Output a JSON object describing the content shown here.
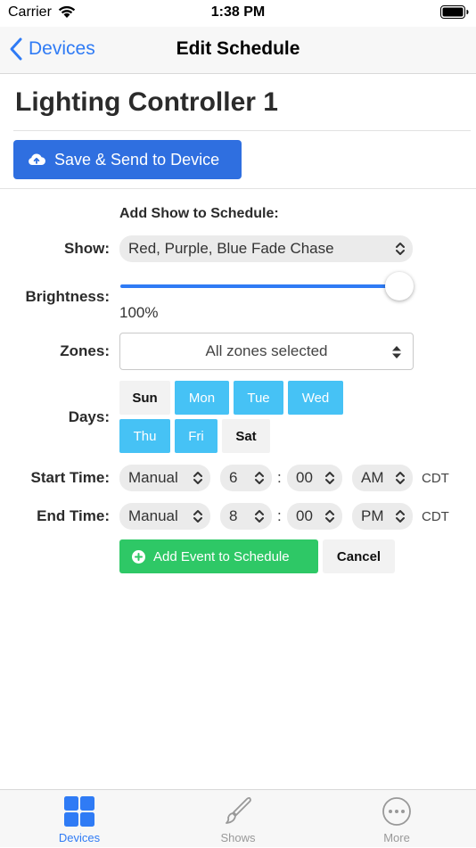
{
  "status_bar": {
    "carrier": "Carrier",
    "time": "1:38 PM"
  },
  "nav": {
    "back_label": "Devices",
    "title": "Edit Schedule"
  },
  "device": {
    "name": "Lighting Controller 1"
  },
  "save_button": {
    "label": "Save & Send to Device",
    "icon": "cloud-upload-icon"
  },
  "form": {
    "heading": "Add Show to Schedule:",
    "show": {
      "label": "Show:",
      "value": "Red, Purple, Blue Fade Chase"
    },
    "brightness": {
      "label": "Brightness:",
      "value_text": "100%",
      "level": 1.0
    },
    "zones": {
      "label": "Zones:",
      "value": "All zones selected"
    },
    "days": {
      "label": "Days:",
      "items": [
        {
          "label": "Sun",
          "selected": false
        },
        {
          "label": "Mon",
          "selected": true
        },
        {
          "label": "Tue",
          "selected": true
        },
        {
          "label": "Wed",
          "selected": true
        },
        {
          "label": "Thu",
          "selected": true
        },
        {
          "label": "Fri",
          "selected": true
        },
        {
          "label": "Sat",
          "selected": false
        }
      ]
    },
    "start_time": {
      "label": "Start Time:",
      "mode": "Manual",
      "hour": "6",
      "separator": ":",
      "minute": "00",
      "ampm": "AM",
      "timezone": "CDT"
    },
    "end_time": {
      "label": "End Time:",
      "mode": "Manual",
      "hour": "8",
      "separator": ":",
      "minute": "00",
      "ampm": "PM",
      "timezone": "CDT"
    },
    "add_event_label": "Add Event to Schedule",
    "cancel_label": "Cancel"
  },
  "tabs": [
    {
      "label": "Devices",
      "icon": "grid-icon",
      "active": true
    },
    {
      "label": "Shows",
      "icon": "brush-icon",
      "active": false
    },
    {
      "label": "More",
      "icon": "more-icon",
      "active": false
    }
  ],
  "colors": {
    "accent": "#2f7bf5",
    "save_button": "#2f6fe0",
    "day_selected": "#46c2f5",
    "add_event": "#2ec866"
  }
}
